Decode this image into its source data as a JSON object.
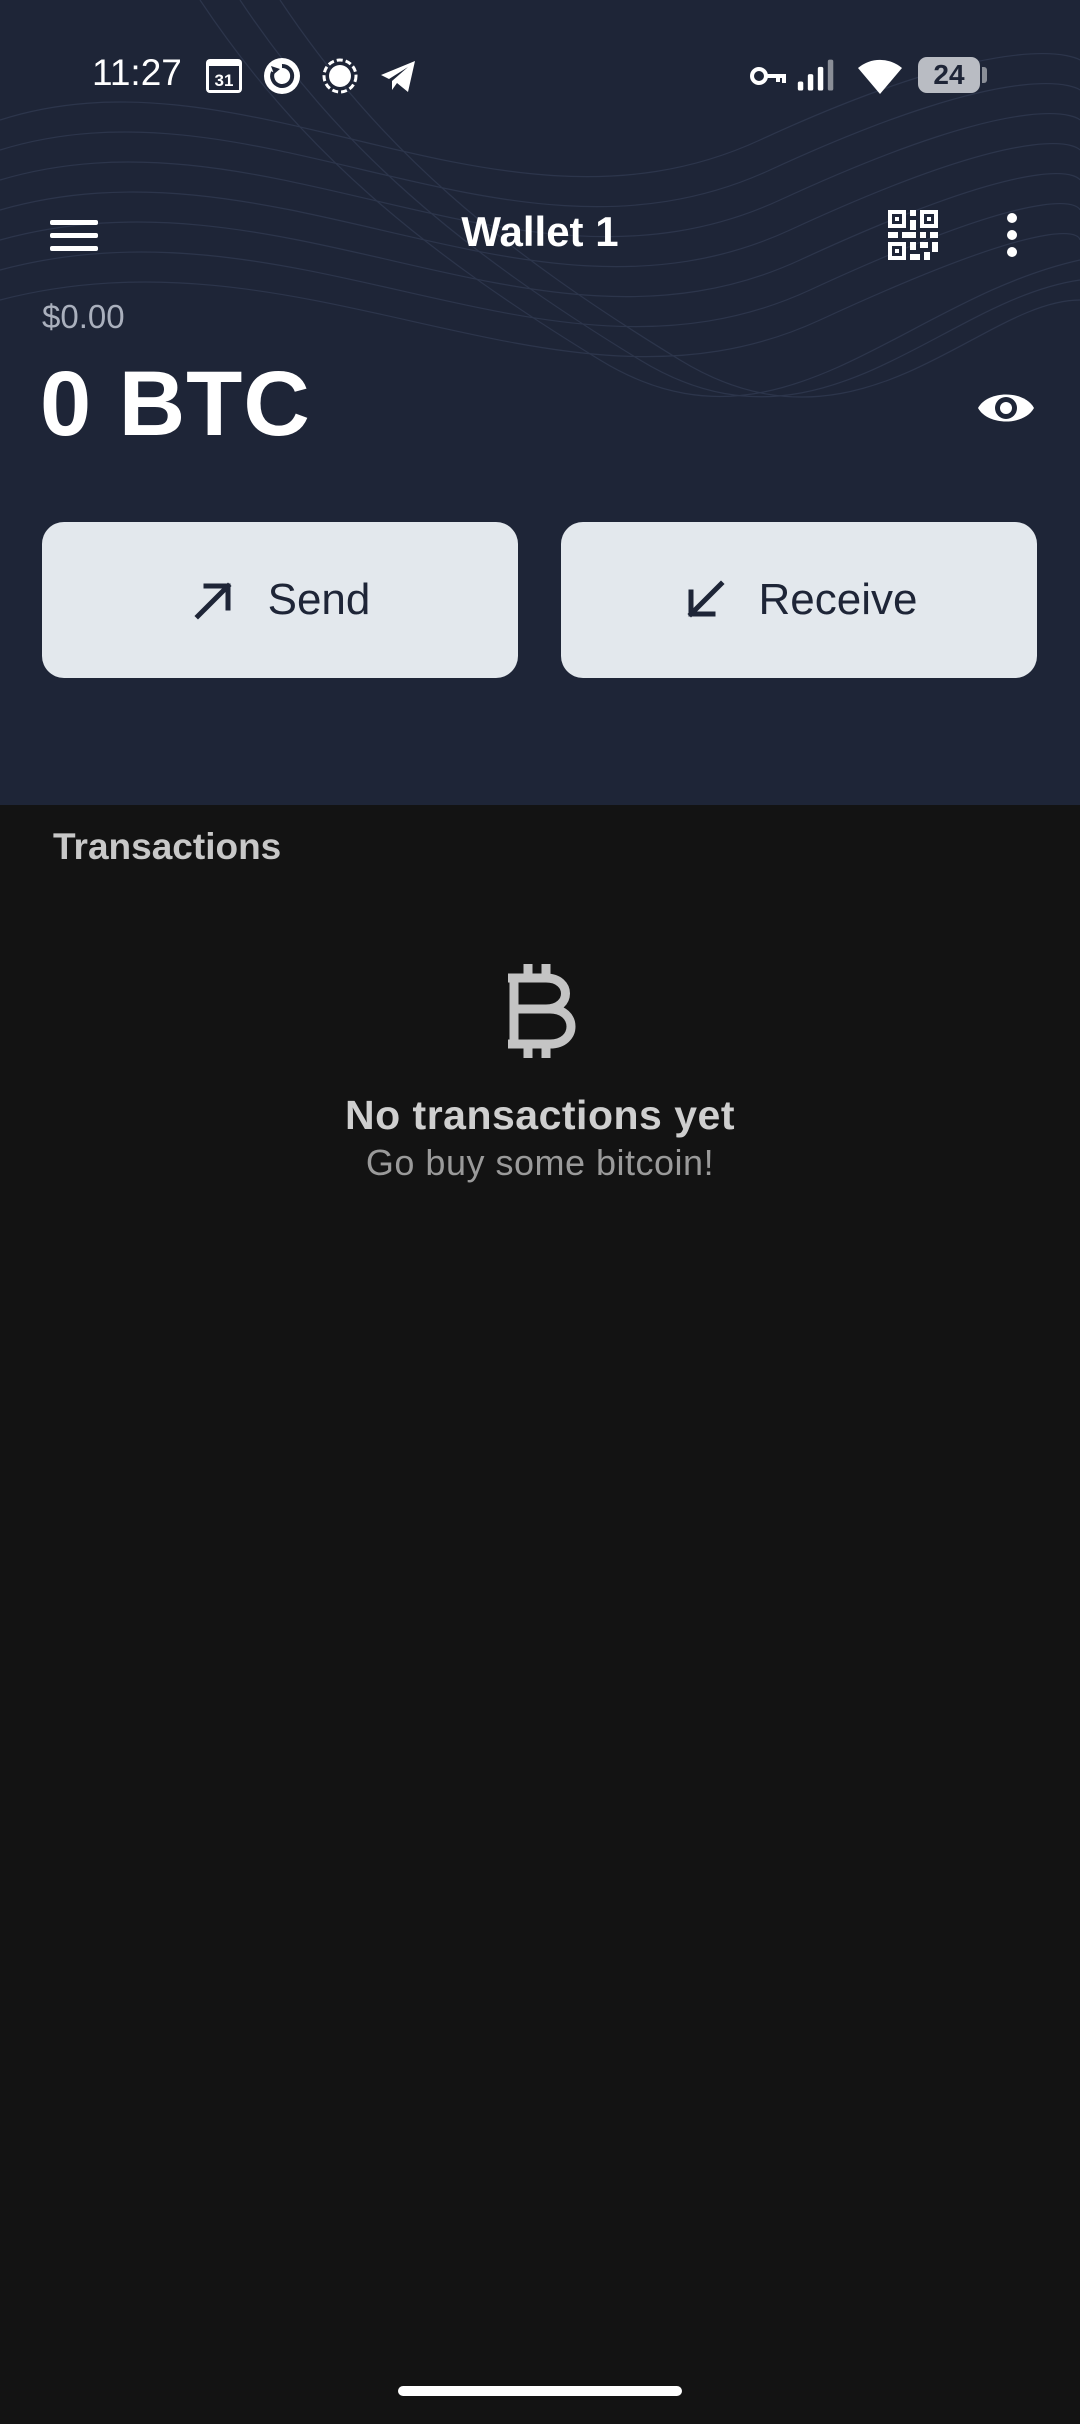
{
  "status_bar": {
    "time": "11:27",
    "calendar_day": "31",
    "battery_level": "24",
    "icons": [
      "calendar-icon",
      "sync-app-icon",
      "signal-app-icon",
      "telegram-icon",
      "vpn-key-icon",
      "cell-signal-icon",
      "wifi-icon",
      "battery-icon"
    ]
  },
  "toolbar": {
    "title": "Wallet 1",
    "menu_icon": "hamburger-menu-icon",
    "qr_icon": "qr-code-icon",
    "more_icon": "more-vertical-icon"
  },
  "balance": {
    "fiat": "$0.00",
    "btc": "0 BTC",
    "visibility_icon": "eye-icon"
  },
  "actions": {
    "send_label": "Send",
    "receive_label": "Receive",
    "send_icon": "arrow-up-right-icon",
    "receive_icon": "arrow-down-left-icon"
  },
  "transactions": {
    "section_title": "Transactions",
    "empty_icon": "bitcoin-icon",
    "empty_title": "No transactions yet",
    "empty_subtitle": "Go buy some bitcoin!"
  },
  "colors": {
    "header_background": "#1e2537",
    "page_background": "#131313",
    "button_background": "#e3e8ed",
    "button_text": "#1e2537"
  }
}
